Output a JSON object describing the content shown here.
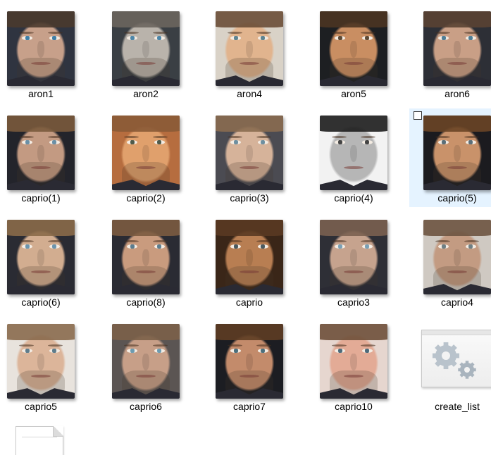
{
  "files": [
    {
      "name": "aron1",
      "skin": "#c7a08a",
      "bg": "#2f3440",
      "hair": "#4a3a2e",
      "iris": "#3f7ea6",
      "beard": true
    },
    {
      "name": "aron2",
      "skin": "#b9b3ab",
      "bg": "#3a3f44",
      "hair": "#6b655e",
      "iris": "#4d86a8",
      "beard": true
    },
    {
      "name": "aron4",
      "skin": "#e1b48e",
      "bg": "#d9d2c7",
      "hair": "#6a4e37",
      "iris": "#5f8390",
      "beard": true
    },
    {
      "name": "aron5",
      "skin": "#c98e62",
      "bg": "#1d1f22",
      "hair": "#4b3422",
      "iris": "#5e4a35",
      "beard": true
    },
    {
      "name": "aron6",
      "skin": "#c99f86",
      "bg": "#2d2f36",
      "hair": "#5a4233",
      "iris": "#4f7e96",
      "beard": true
    },
    {
      "name": "caprio(1)",
      "skin": "#c39a82",
      "bg": "#23242b",
      "hair": "#7a5a3c",
      "iris": "#6a8fa6",
      "beard": true
    },
    {
      "name": "caprio(2)",
      "skin": "#e0a06c",
      "bg": "#b66d3f",
      "hair": "#8a5a36",
      "iris": "#4e5a4a",
      "beard": true
    },
    {
      "name": "caprio(3)",
      "skin": "#d6b39a",
      "bg": "#4b4b52",
      "hair": "#8a6c50",
      "iris": "#6e8fa0",
      "beard": true
    },
    {
      "name": "caprio(4)",
      "skin": "#b6b6b6",
      "bg": "#f2f2f2",
      "hair": "#1c1c1c",
      "iris": "#444444",
      "beard": false
    },
    {
      "name": "caprio(5)",
      "skin": "#c9926a",
      "bg": "#1b1b1f",
      "hair": "#6a4526",
      "iris": "#5a6e78",
      "beard": true,
      "selected": true
    },
    {
      "name": "caprio(6)",
      "skin": "#d2ad90",
      "bg": "#2a2b33",
      "hair": "#8a6a49",
      "iris": "#6c95ae",
      "beard": true
    },
    {
      "name": "caprio(8)",
      "skin": "#c99b7e",
      "bg": "#2a2b33",
      "hair": "#7b5b40",
      "iris": "#5b7d8f",
      "beard": true
    },
    {
      "name": "caprio",
      "skin": "#b87e52",
      "bg": "#3a2618",
      "hair": "#5a3a22",
      "iris": "#4a5a60",
      "beard": true
    },
    {
      "name": "caprio3",
      "skin": "#c6a38e",
      "bg": "#2e2f36",
      "hair": "#7a6050",
      "iris": "#7aa0b5",
      "beard": true
    },
    {
      "name": "caprio4",
      "skin": "#c39b82",
      "bg": "#cfc9c2",
      "hair": "#6d5441",
      "iris": "#6e7f84",
      "beard": true
    },
    {
      "name": "caprio5",
      "skin": "#dcb59a",
      "bg": "#e8e3dd",
      "hair": "#8a6a4e",
      "iris": "#5f7c8b",
      "beard": true
    },
    {
      "name": "caprio6",
      "skin": "#c79f88",
      "bg": "#5b5553",
      "hair": "#7b6049",
      "iris": "#6d9bb0",
      "beard": true
    },
    {
      "name": "caprio7",
      "skin": "#c38b6b",
      "bg": "#1c1d22",
      "hair": "#5e3d24",
      "iris": "#4b6f7c",
      "beard": true
    },
    {
      "name": "caprio10",
      "skin": "#e3ab96",
      "bg": "#e6d6cf",
      "hair": "#6e503a",
      "iris": "#4d6a7a",
      "beard": true
    },
    {
      "name": "create_list",
      "type": "script",
      "icon": "gears-icon"
    }
  ]
}
